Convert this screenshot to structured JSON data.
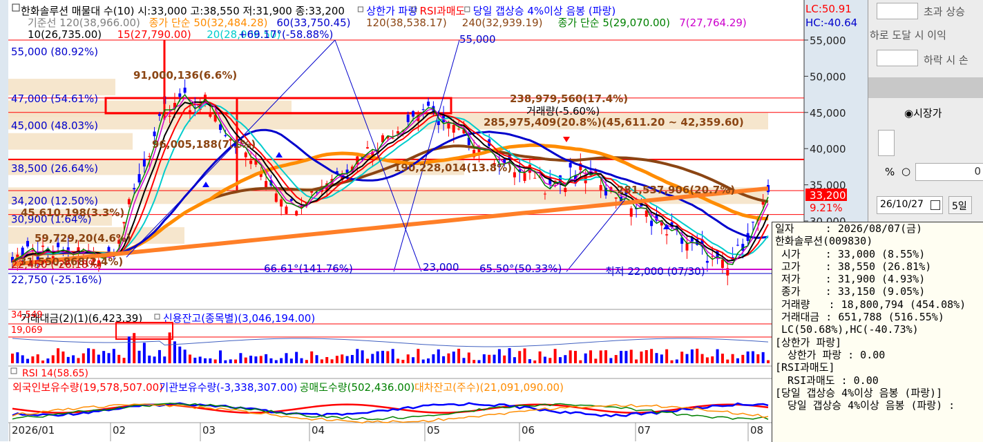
{
  "price_chart": {
    "legend_row1": [
      {
        "text": "한화솔루션 매물대 수(10)  시:33,000 고:38,550 저:31,900 종:33,200",
        "color": "#000000"
      },
      {
        "text": "상한가 파랑",
        "color": "#0000ff"
      },
      {
        "text": "RSI과매도",
        "color": "#ff0000"
      },
      {
        "text": "당일 갭상승 4%이상 음봉 (파랑)",
        "color": "#0000ff"
      }
    ],
    "legend_row2": [
      {
        "text": "기준선 120(38,966.00)",
        "color": "#808080"
      },
      {
        "text": "종가 단순 50(32,484.28)",
        "color": "#ff8c00"
      },
      {
        "text": "60(33,750.45)",
        "color": "#0000cc"
      },
      {
        "text": "120(38,538.17)",
        "color": "#8b4513"
      },
      {
        "text": "240(32,939.19)",
        "color": "#8b4513"
      },
      {
        "text": "종가 단순 5(29,070.00)",
        "color": "#008000"
      },
      {
        "text": "7(27,764.29)",
        "color": "#cc00cc"
      }
    ],
    "legend_row3": [
      {
        "text": "10(26,735.00)",
        "color": "#000000"
      },
      {
        "text": "15(27,790.00)",
        "color": "#ff0000"
      },
      {
        "text": "20(28,006.50)",
        "color": "#00cccc"
      }
    ],
    "lc_label": "LC:50.91",
    "hc_label": "HC:-40.64",
    "y_ticks": [
      "55,000",
      "50,000",
      "45,000",
      "40,000",
      "35,000",
      "30,000"
    ],
    "current_price": "33,200",
    "current_change": "9.21%",
    "hline_labels": [
      {
        "text": "47,000 (54.61%)",
        "color": "#0000cc"
      },
      {
        "text": "45,000 (48.03%)",
        "color": "#0000cc"
      },
      {
        "text": "38,500 (26.64%)",
        "color": "#0000cc"
      },
      {
        "text": "34,200 (12.50%)",
        "color": "#0000cc"
      },
      {
        "text": "30,900 (1.64%)",
        "color": "#0000cc"
      },
      {
        "text": "22,750 (-25.16%)",
        "color": "#0000cc"
      },
      {
        "text": "55,000 (80.92%)",
        "color": "#0000cc"
      }
    ],
    "volume_profile_labels": [
      "91,000,136(6.6%)",
      "238,979,560(17.4%)",
      "285,975,409(20.8%)(45,611.20 ~ 42,359.60)",
      "96,005,188(7.1%)",
      "190,228,014(13.8%)",
      "281,537,906(20.7%)",
      "45,610,198(3.3%)",
      "59,729,20(4.6%)",
      "31,550,868(2.4%)"
    ],
    "annotations": [
      {
        "text": "55,000",
        "color": "#0000cc"
      },
      {
        "text": "+69.17°(-58.88%)",
        "color": "#0000cc"
      },
      {
        "text": "66.61°(141.76%)",
        "color": "#0000cc"
      },
      {
        "text": "23,000",
        "color": "#0000cc"
      },
      {
        "text": "65.50°(50.33%)",
        "color": "#0000cc"
      },
      {
        "text": "최저 22,000 (07/30)",
        "color": "#0000cc"
      },
      {
        "text": "거래량(-5.60%)",
        "color": "#000000"
      },
      {
        "text": "22,450 (-26.18%)",
        "color": "#cc0000"
      }
    ]
  },
  "volume_panel": {
    "legend": [
      {
        "text": "거래대금(2)(1)(6,423.39)",
        "color": "#000000"
      },
      {
        "text": "신용잔고(종목별)(3,046,194.00)",
        "color": "#0000ff"
      }
    ],
    "labels": [
      "34,549",
      "19,069"
    ]
  },
  "rsi_panel": {
    "label": "RSI 14(58.65)"
  },
  "holdings_panel": {
    "legend": [
      {
        "text": "외국인보유수량(19,578,507.00)",
        "color": "#ff0000"
      },
      {
        "text": "기관보유수량(-3,338,307.00)",
        "color": "#0000ff"
      },
      {
        "text": "공매도수량(502,436.00)",
        "color": "#008000"
      },
      {
        "text": "대차잔고(주수)(21,091,090.00)",
        "color": "#ff8c00"
      }
    ]
  },
  "x_axis": {
    "labels": [
      "2026/01",
      "02",
      "03",
      "04",
      "05",
      "06",
      "07",
      "08"
    ]
  },
  "right_panel": {
    "over_up_label": "초과 상승",
    "down_reach_label": "하로 도달 시 이익",
    "down_label": "하락 시 손",
    "market_price_label": "◉시장가",
    "percent_label": "%",
    "radio_label": "○",
    "zero_value": "0",
    "date_value": "26/10/27",
    "days_button": "5일"
  },
  "info_box": {
    "lines": [
      "일자     : 2026/08/07(금)",
      "한화솔루션(009830)",
      " 시가    : 33,000 (8.55%)",
      " 고가    : 38,550 (26.81%)",
      " 저가    : 31,900 (4.93%)",
      " 종가    : 33,150 (9.05%)",
      " 거래량   : 18,800,794 (454.08%)",
      " 거래대금 : 651,788 (516.55%)",
      " LC(50.68%),HC(-40.73%)",
      "[상한가 파랑]",
      "  상한가 파랑 : 0.00",
      "[RSI과매도]",
      "  RSI과매도 : 0.00",
      "[당일 갭상승 4%이상 음봉 (파랑)]",
      "  당일 갭상승 4%이상 음봉 (파랑) :"
    ]
  },
  "colors": {
    "up": "#ff0000",
    "down": "#0000ff",
    "bg_panel": "#dde7f0",
    "profile": "#f5deb3"
  }
}
